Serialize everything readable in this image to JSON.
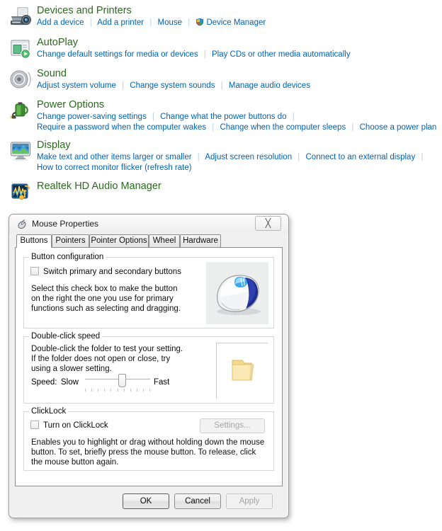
{
  "control_panel": {
    "sections": [
      {
        "icon": "printers-and-devices-icon",
        "title": "Devices and Printers",
        "link_rows": [
          [
            {
              "label": "Add a device",
              "shield": false
            },
            {
              "label": "Add a printer",
              "shield": false
            },
            {
              "label": "Mouse",
              "shield": false
            },
            {
              "label": "Device Manager",
              "shield": true
            }
          ]
        ]
      },
      {
        "icon": "autoplay-icon",
        "title": "AutoPlay",
        "link_rows": [
          [
            {
              "label": "Change default settings for media or devices",
              "shield": false
            },
            {
              "label": "Play CDs or other media automatically",
              "shield": false
            }
          ]
        ]
      },
      {
        "icon": "sound-speaker-icon",
        "title": "Sound",
        "link_rows": [
          [
            {
              "label": "Adjust system volume",
              "shield": false
            },
            {
              "label": "Change system sounds",
              "shield": false
            },
            {
              "label": "Manage audio devices",
              "shield": false
            }
          ]
        ]
      },
      {
        "icon": "power-battery-icon",
        "title": "Power Options",
        "link_rows": [
          [
            {
              "label": "Change power-saving settings",
              "shield": false
            },
            {
              "label": "Change what the power buttons do",
              "shield": false
            },
            {
              "label": "",
              "shield": false
            }
          ],
          [
            {
              "label": "Require a password when the computer wakes",
              "shield": false
            },
            {
              "label": "Change when the computer sleeps",
              "shield": false
            },
            {
              "label": "Choose a power plan",
              "shield": false
            }
          ]
        ]
      },
      {
        "icon": "display-monitor-icon",
        "title": "Display",
        "link_rows": [
          [
            {
              "label": "Make text and other items larger or smaller",
              "shield": false
            },
            {
              "label": "Adjust screen resolution",
              "shield": false
            },
            {
              "label": "Connect to an external display",
              "shield": false
            },
            {
              "label": "",
              "shield": false
            }
          ],
          [
            {
              "label": "How to correct monitor flicker (refresh rate)",
              "shield": false
            }
          ]
        ]
      },
      {
        "icon": "realtek-audio-icon",
        "title": "Realtek HD Audio Manager",
        "link_rows": []
      }
    ]
  },
  "dialog": {
    "title": "Mouse Properties",
    "icon": "mouse-icon",
    "close_glyph": "╳",
    "tabs": [
      {
        "label": "Buttons",
        "selected": true
      },
      {
        "label": "Pointers",
        "selected": false
      },
      {
        "label": "Pointer Options",
        "selected": false
      },
      {
        "label": "Wheel",
        "selected": false
      },
      {
        "label": "Hardware",
        "selected": false
      }
    ],
    "button_configuration": {
      "legend": "Button configuration",
      "checkbox_label": "Switch primary and secondary buttons",
      "checkbox_checked": false,
      "description": "Select this check box to make the button on the right the one you use for primary functions such as selecting and dragging.",
      "preview_icon": "mouse-preview-image"
    },
    "double_click_speed": {
      "legend": "Double-click speed",
      "description": "Double-click the folder to test your setting. If the folder does not open or close, try using a slower setting.",
      "speed_label": "Speed:",
      "slow_label": "Slow",
      "fast_label": "Fast",
      "slider_value": 58,
      "slider_min": 0,
      "slider_max": 100,
      "tick_count": 11,
      "test_icon": "folder-test-icon"
    },
    "clicklock": {
      "legend": "ClickLock",
      "checkbox_label": "Turn on ClickLock",
      "checkbox_checked": false,
      "settings_button": "Settings...",
      "settings_enabled": false,
      "description": "Enables you to highlight or drag without holding down the mouse button. To set, briefly press the mouse button. To release, click the mouse button again."
    },
    "footer": {
      "ok": "OK",
      "cancel": "Cancel",
      "apply": "Apply",
      "apply_enabled": false
    }
  },
  "colors": {
    "heading_green": "#2a6b1e",
    "link_blue": "#0062b5",
    "separator": "#b9cfe2",
    "dialog_face": "#f0f0f0",
    "page_bg": "#ffffff"
  }
}
